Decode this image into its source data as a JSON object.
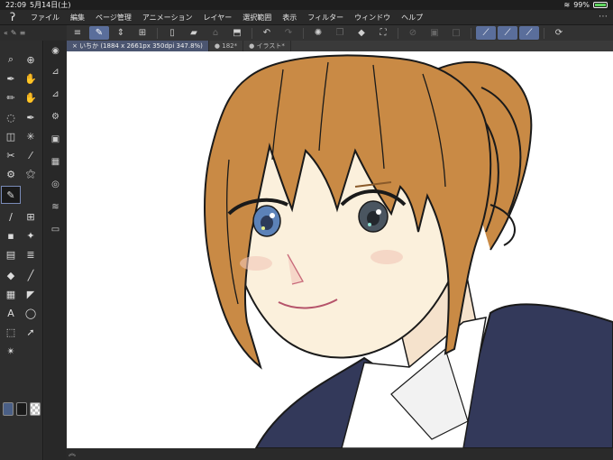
{
  "status_bar": {
    "time": "22:09",
    "date": "5月14日(土)",
    "battery": "99%"
  },
  "menu": {
    "items": [
      "ファイル",
      "編集",
      "ページ管理",
      "アニメーション",
      "レイヤー",
      "選択範囲",
      "表示",
      "フィルター",
      "ウィンドウ",
      "ヘルプ"
    ]
  },
  "tabs": [
    {
      "label": "× いちか (1884 x 2661px 350dpi 347.8%)",
      "active": true
    },
    {
      "label": "● 182*",
      "active": false
    },
    {
      "label": "● イラスト*",
      "active": false
    }
  ],
  "colors": {
    "main_color": "#4a5f86",
    "sub_color": "#1a1a1a",
    "accent": "#5a6e9b",
    "hair": "#c98a45",
    "uniform": "#33395a"
  },
  "illustration_name": "anime-girl-illustration"
}
